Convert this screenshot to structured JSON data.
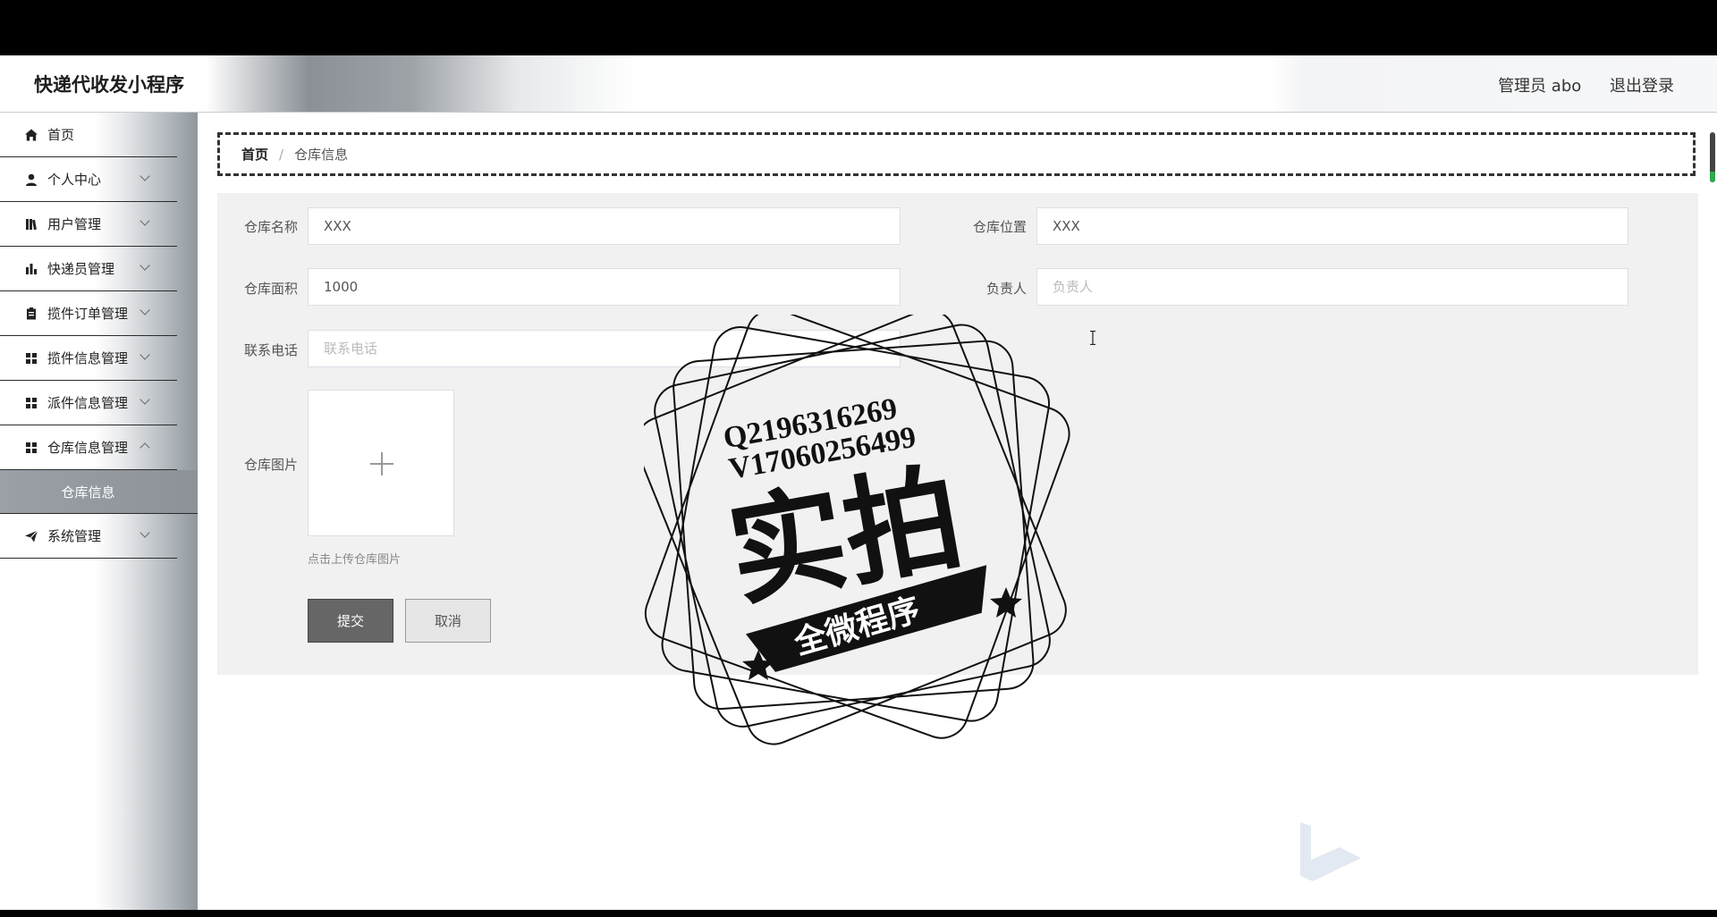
{
  "app": {
    "title": "快递代收发小程序"
  },
  "header": {
    "user": "管理员 abo",
    "logout": "退出登录"
  },
  "sidebar": {
    "items": [
      {
        "label": "首页",
        "icon": "home-icon"
      },
      {
        "label": "个人中心",
        "icon": "user-icon"
      },
      {
        "label": "用户管理",
        "icon": "book-icon"
      },
      {
        "label": "快递员管理",
        "icon": "bar-chart-icon"
      },
      {
        "label": "揽件订单管理",
        "icon": "clipboard-icon"
      },
      {
        "label": "揽件信息管理",
        "icon": "grid-icon"
      },
      {
        "label": "派件信息管理",
        "icon": "grid-icon"
      },
      {
        "label": "仓库信息管理",
        "icon": "grid-icon"
      },
      {
        "label": "仓库信息",
        "icon": ""
      },
      {
        "label": "系统管理",
        "icon": "send-icon"
      }
    ]
  },
  "breadcrumb": {
    "home": "首页",
    "separator": "/",
    "current": "仓库信息"
  },
  "form": {
    "name": {
      "label": "仓库名称",
      "value": "XXX"
    },
    "location": {
      "label": "仓库位置",
      "value": "XXX"
    },
    "area": {
      "label": "仓库面积",
      "value": "1000"
    },
    "manager": {
      "label": "负责人",
      "placeholder": "负责人"
    },
    "phone": {
      "label": "联系电话",
      "placeholder": "联系电话"
    },
    "image": {
      "label": "仓库图片",
      "tip": "点击上传仓库图片"
    },
    "submit": "提交",
    "cancel": "取消"
  },
  "watermark": {
    "line1": "Q2196316269",
    "line2": "V17060256499",
    "main": "实拍",
    "banner": "全微程序"
  }
}
